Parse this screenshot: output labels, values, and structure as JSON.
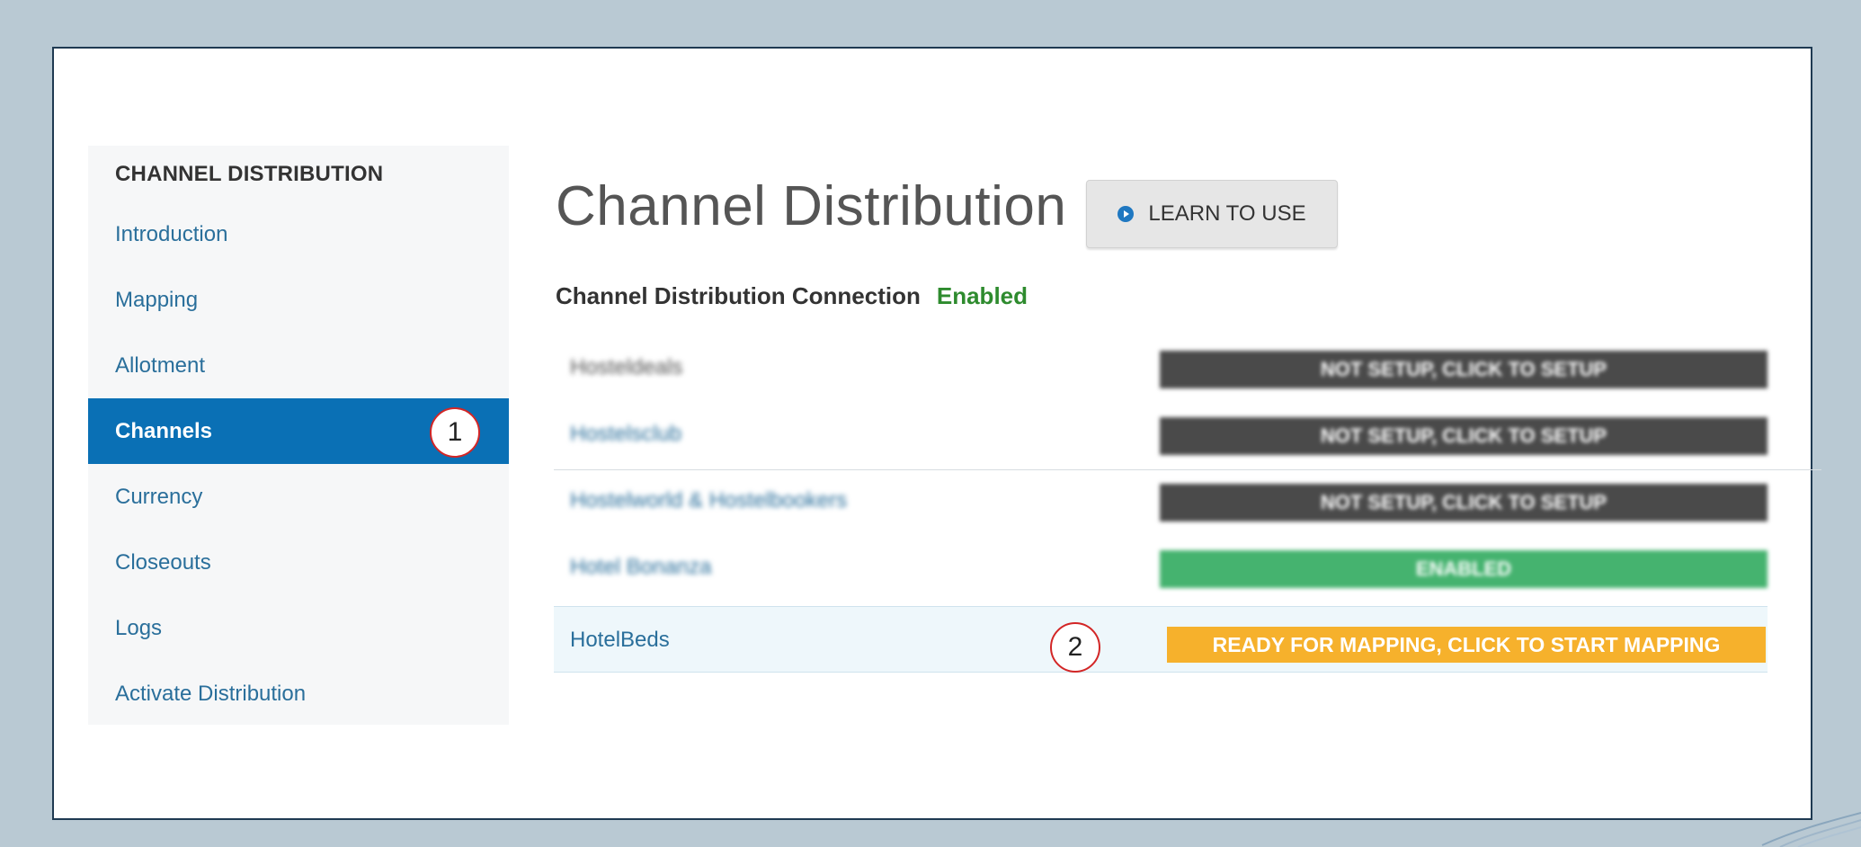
{
  "sidebar": {
    "heading": "CHANNEL DISTRIBUTION",
    "items": [
      {
        "label": "Introduction",
        "active": false
      },
      {
        "label": "Mapping",
        "active": false
      },
      {
        "label": "Allotment",
        "active": false
      },
      {
        "label": "Channels",
        "active": true
      },
      {
        "label": "Currency",
        "active": false
      },
      {
        "label": "Closeouts",
        "active": false
      },
      {
        "label": "Logs",
        "active": false
      },
      {
        "label": "Activate Distribution",
        "active": false
      }
    ]
  },
  "main": {
    "title": "Channel Distribution",
    "learn_button": {
      "label": "LEARN TO USE",
      "icon": "play-circle-icon"
    },
    "connection": {
      "label": "Channel Distribution Connection",
      "status": "Enabled",
      "status_color": "#2e8b2e"
    },
    "channels": [
      {
        "name": "Hosteldeals",
        "status": "NOT SETUP, CLICK TO SETUP",
        "status_color": "#4a4a4a"
      },
      {
        "name": "Hostelsclub",
        "status": "NOT SETUP, CLICK TO SETUP",
        "status_color": "#4a4a4a"
      },
      {
        "name": "Hostelworld & Hostelbookers",
        "status": "NOT SETUP, CLICK TO SETUP",
        "status_color": "#4a4a4a"
      },
      {
        "name": "Hotel Bonanza",
        "status": "ENABLED",
        "status_color": "#45b36f"
      },
      {
        "name": "HotelBeds",
        "status": "READY FOR MAPPING, CLICK TO START MAPPING",
        "status_color": "#f6b12c"
      }
    ]
  },
  "callouts": [
    "1",
    "2"
  ],
  "colors": {
    "accent": "#0a70b5",
    "background": "#b9c9d3",
    "frame_border": "#1f3a52",
    "callout_border": "#d32626"
  }
}
